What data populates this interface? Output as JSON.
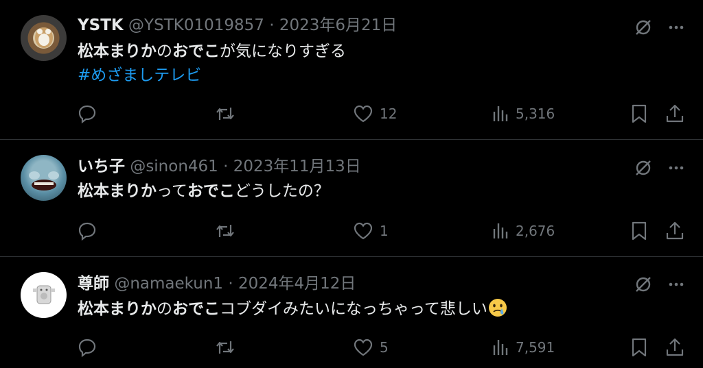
{
  "tweets": [
    {
      "name": "YSTK",
      "handle": "@YSTK01019857",
      "sep": " · ",
      "date": "2023年6月21日",
      "text": {
        "b1": "松本まりか",
        "t1": "の",
        "b2": "おでこ",
        "t2": "が気になりすぎる"
      },
      "hashtag": "#めざましテレビ",
      "likes": "12",
      "views": "5,316"
    },
    {
      "name": "いち子",
      "handle": "@sinon461",
      "sep": " · ",
      "date": "2023年11月13日",
      "text": {
        "b1": "松本まりか",
        "t1": "って",
        "b2": "おでこ",
        "t2": "どうしたの？"
      },
      "likes": "1",
      "views": "2,676"
    },
    {
      "name": "尊師",
      "handle": "@namaekun1",
      "sep": " · ",
      "date": "2024年4月12日",
      "text": {
        "b1": "松本まりか",
        "t1": "の",
        "b2": "おでこ",
        "t2": "コブダイみたいになっちゃって悲しい"
      },
      "emoji": "crying-face-emoji",
      "likes": "5",
      "views": "7,591"
    }
  ],
  "icons": {
    "reply": "reply-icon",
    "retweet": "retweet-icon",
    "like": "heart-icon",
    "views": "views-icon",
    "bookmark": "bookmark-icon",
    "share": "share-icon",
    "grok": "grok-icon",
    "more": "more-icon"
  },
  "colors": {
    "background": "#000000",
    "text": "#e7e9ea",
    "muted": "#71767b",
    "link": "#1d9bf0",
    "divider": "#2f3336"
  }
}
